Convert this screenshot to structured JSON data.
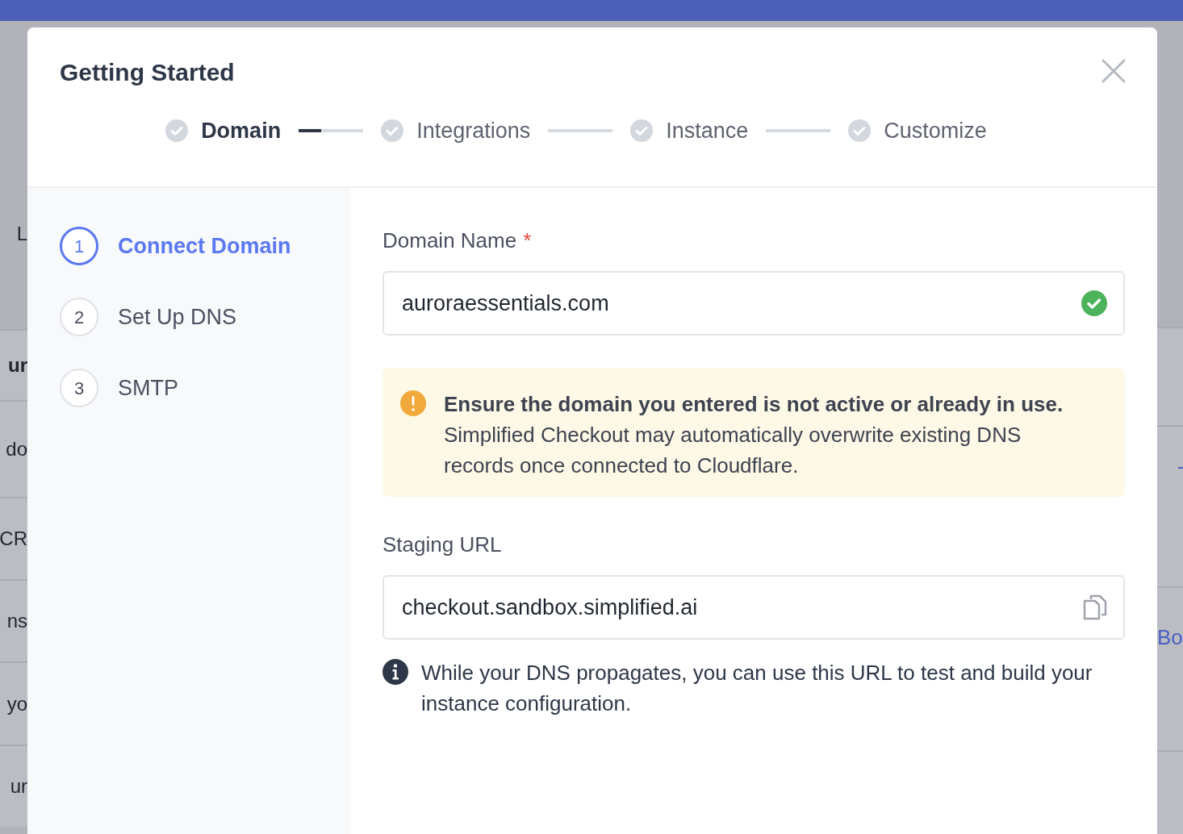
{
  "background": {
    "left_texts": [
      {
        "text": "L",
        "kind": "plain"
      },
      {
        "text": "ur",
        "kind": "bold"
      },
      {
        "text": "do",
        "kind": "plain"
      },
      {
        "text": "CR",
        "kind": "plain"
      },
      {
        "text": "ns",
        "kind": "plain"
      },
      {
        "text": "yo",
        "kind": "plain"
      },
      {
        "text": "ur",
        "kind": "plain"
      }
    ],
    "right_link": "Bo"
  },
  "dialog": {
    "title": "Getting Started",
    "steps": [
      {
        "label": "Domain",
        "selected": true
      },
      {
        "label": "Integrations",
        "selected": false
      },
      {
        "label": "Instance",
        "selected": false
      },
      {
        "label": "Customize",
        "selected": false
      }
    ],
    "connectors": [
      {
        "level": 0.35
      },
      {
        "level": 0
      },
      {
        "level": 0
      }
    ],
    "substeps": [
      {
        "number": "1",
        "label": "Connect Domain",
        "selected": true
      },
      {
        "number": "2",
        "label": "Set Up DNS",
        "selected": false
      },
      {
        "number": "3",
        "label": "SMTP",
        "selected": false
      }
    ],
    "domain_field": {
      "label": "Domain Name",
      "required_mark": "*",
      "value": "auroraessentials.com",
      "valid": true
    },
    "alert": {
      "text": "**Ensure the domain you entered is not active or already in use.** Simplified Checkout may automatically overwrite existing DNS records once connected to Cloudflare."
    },
    "staging_field": {
      "label": "Staging URL",
      "value": "checkout.sandbox.simplified.ai"
    },
    "note": "While your DNS propagates, you can use this URL to test and build your instance configuration."
  }
}
